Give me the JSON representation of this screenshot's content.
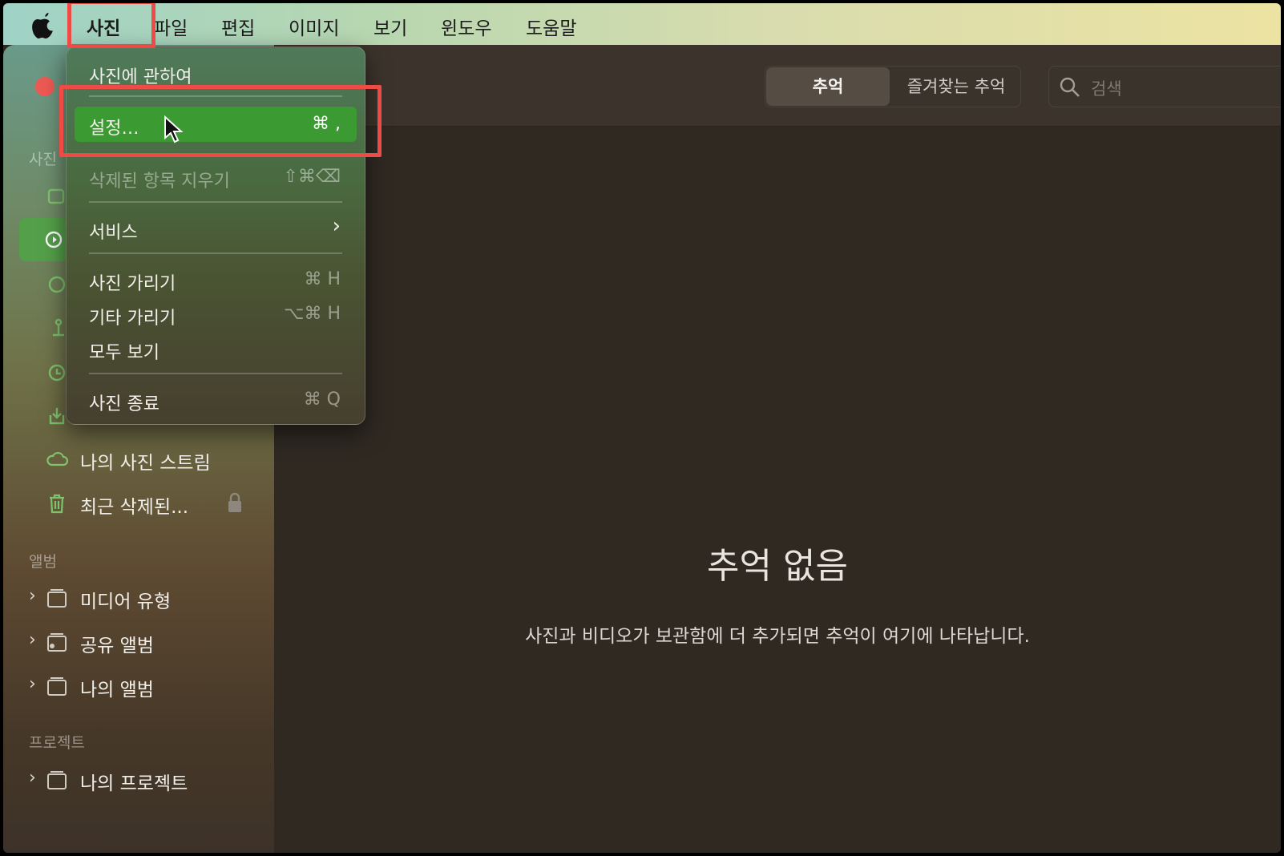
{
  "menubar": {
    "items": [
      "사진",
      "파일",
      "편집",
      "이미지",
      "보기",
      "윈도우",
      "도움말"
    ],
    "apple_icon": "apple-logo-icon"
  },
  "dropdown": {
    "about": "사진에 관하여",
    "settings": {
      "label": "설정…",
      "shortcut": "⌘ ,"
    },
    "empty_trash": {
      "label": "삭제된 항목 지우기",
      "shortcut": "⇧⌘⌫"
    },
    "services": {
      "label": "서비스",
      "arrow": "›"
    },
    "hide_photos": {
      "label": "사진 가리기",
      "shortcut": "⌘ H"
    },
    "hide_others": {
      "label": "기타 가리기",
      "shortcut": "⌥⌘ H"
    },
    "show_all": {
      "label": "모두 보기"
    },
    "quit": {
      "label": "사진 종료",
      "shortcut": "⌘ Q"
    }
  },
  "sidebar": {
    "section_photos": "사진",
    "stream": "나의 사진 스트림",
    "recently_deleted": "최근 삭제된...",
    "section_albums": "앨범",
    "albums": [
      "미디어 유형",
      "공유 앨범",
      "나의 앨범"
    ],
    "section_projects": "프로젝트",
    "projects": [
      "나의 프로젝트"
    ]
  },
  "toolbar": {
    "segments": [
      "추억",
      "즐겨찾는 추억"
    ],
    "search_placeholder": "검색"
  },
  "main": {
    "empty_title": "추억 없음",
    "empty_subtitle": "사진과 비디오가 보관함에 더 추가되면 추억이 여기에 나타납니다."
  },
  "colors": {
    "highlight_green": "#3c9a33",
    "annotation_red": "#ee4a46",
    "window_red": "#ee5a53"
  }
}
